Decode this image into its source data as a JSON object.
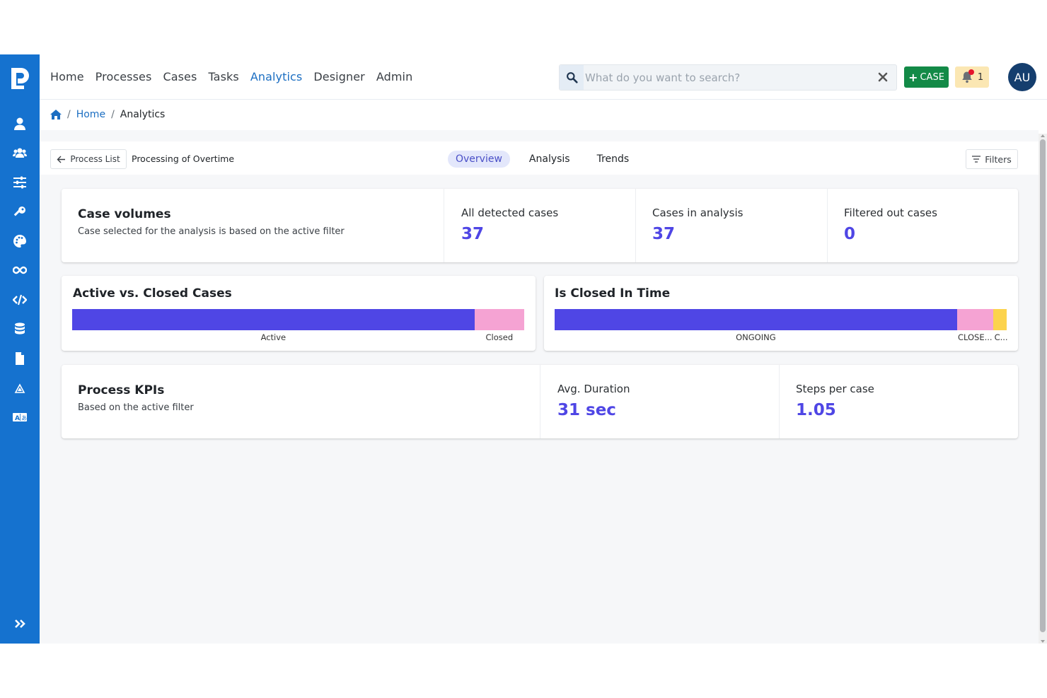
{
  "nav": {
    "items": [
      {
        "label": "Home",
        "active": false
      },
      {
        "label": "Processes",
        "active": false
      },
      {
        "label": "Cases",
        "active": false
      },
      {
        "label": "Tasks",
        "active": false
      },
      {
        "label": "Analytics",
        "active": true
      },
      {
        "label": "Designer",
        "active": false
      },
      {
        "label": "Admin",
        "active": false
      }
    ]
  },
  "search": {
    "placeholder": "What do you want to search?"
  },
  "new_case": {
    "label": "CASE"
  },
  "notifications": {
    "count": "1"
  },
  "user": {
    "initials": "AU"
  },
  "sidebar": {
    "icons": [
      "user-icon",
      "users-icon",
      "sliders-icon",
      "key-icon",
      "palette-icon",
      "infinity-icon",
      "code-icon",
      "database-icon",
      "file-icon",
      "triangle-icon",
      "translate-icon"
    ],
    "expand_icon": "chevrons-right-icon"
  },
  "breadcrumb": {
    "home": "Home",
    "current": "Analytics"
  },
  "toolbar": {
    "back_label": "Process List",
    "process_name": "Processing of Overtime",
    "tabs": [
      {
        "label": "Overview",
        "active": true
      },
      {
        "label": "Analysis",
        "active": false
      },
      {
        "label": "Trends",
        "active": false
      }
    ],
    "filters_label": "Filters"
  },
  "case_volumes": {
    "title": "Case volumes",
    "subtitle": "Case selected for the analysis is based on the active filter",
    "metrics": [
      {
        "label": "All detected cases",
        "value": "37"
      },
      {
        "label": "Cases in analysis",
        "value": "37"
      },
      {
        "label": "Filtered out cases",
        "value": "0"
      }
    ]
  },
  "active_closed": {
    "title": "Active vs. Closed Cases",
    "segments": [
      {
        "label": "Active",
        "fraction": 0.89,
        "color": "#4f46e5"
      },
      {
        "label": "Closed",
        "fraction": 0.11,
        "color": "#f5a3d3"
      }
    ]
  },
  "closed_in_time": {
    "title": "Is Closed In Time",
    "segments": [
      {
        "label": "ONGOING",
        "fraction": 0.89,
        "color": "#4f46e5"
      },
      {
        "label": "CLOSE...",
        "fraction": 0.08,
        "color": "#f5a3d3"
      },
      {
        "label": "C...",
        "fraction": 0.03,
        "color": "#fcd34d"
      }
    ]
  },
  "kpis": {
    "title": "Process KPIs",
    "subtitle": "Based on the active filter",
    "metrics": [
      {
        "label": "Avg. Duration",
        "value": "31 sec"
      },
      {
        "label": "Steps per case",
        "value": "1.05"
      }
    ]
  },
  "colors": {
    "sidebar": "#1572cf",
    "accent": "#4f46e5",
    "nav_active": "#1b6ec2",
    "new_case": "#138a47"
  }
}
